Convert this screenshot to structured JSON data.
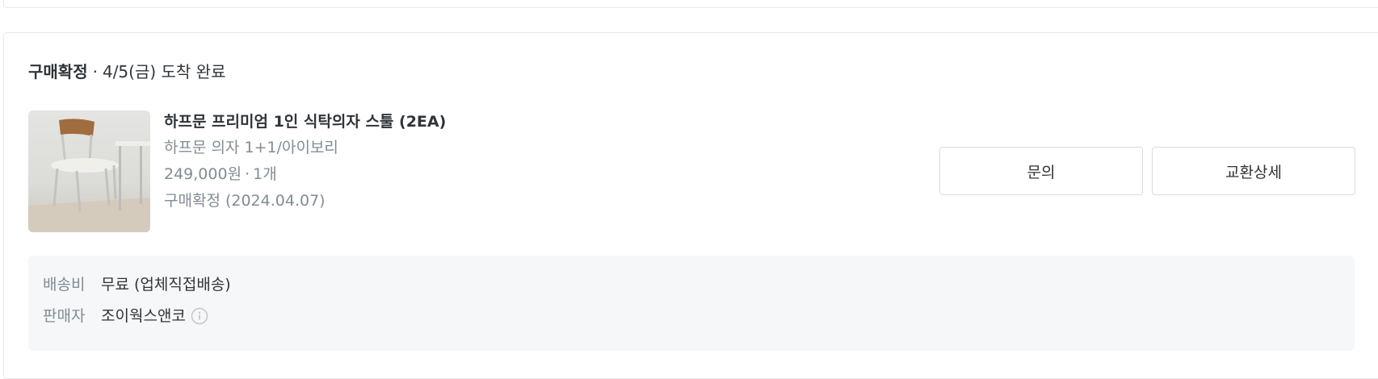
{
  "order": {
    "status_label": "구매확정",
    "status_dot": "·",
    "arrival_text": "4/5(금) 도착 완료",
    "product": {
      "image_icon": "chair-product-image",
      "title": "하프문 프리미엄 1인 식탁의자 스툴 (2EA)",
      "option": "하프문 의자 1+1/아이보리",
      "price": "249,000원",
      "price_qty_sep": "·",
      "quantity": "1개",
      "confirm_status": "구매확정 (2024.04.07)"
    },
    "actions": {
      "inquiry_label": "문의",
      "exchange_detail_label": "교환상세"
    },
    "delivery": {
      "fee_label": "배송비",
      "fee_value": "무료 (업체직접배송)",
      "seller_label": "판매자",
      "seller_value": "조이웍스앤코",
      "seller_info_icon": "info-circle-icon"
    }
  },
  "colors": {
    "text_primary": "#2f3438",
    "text_secondary": "#828c94",
    "border": "#dadce0",
    "delivery_bg": "#f5f7f8"
  }
}
